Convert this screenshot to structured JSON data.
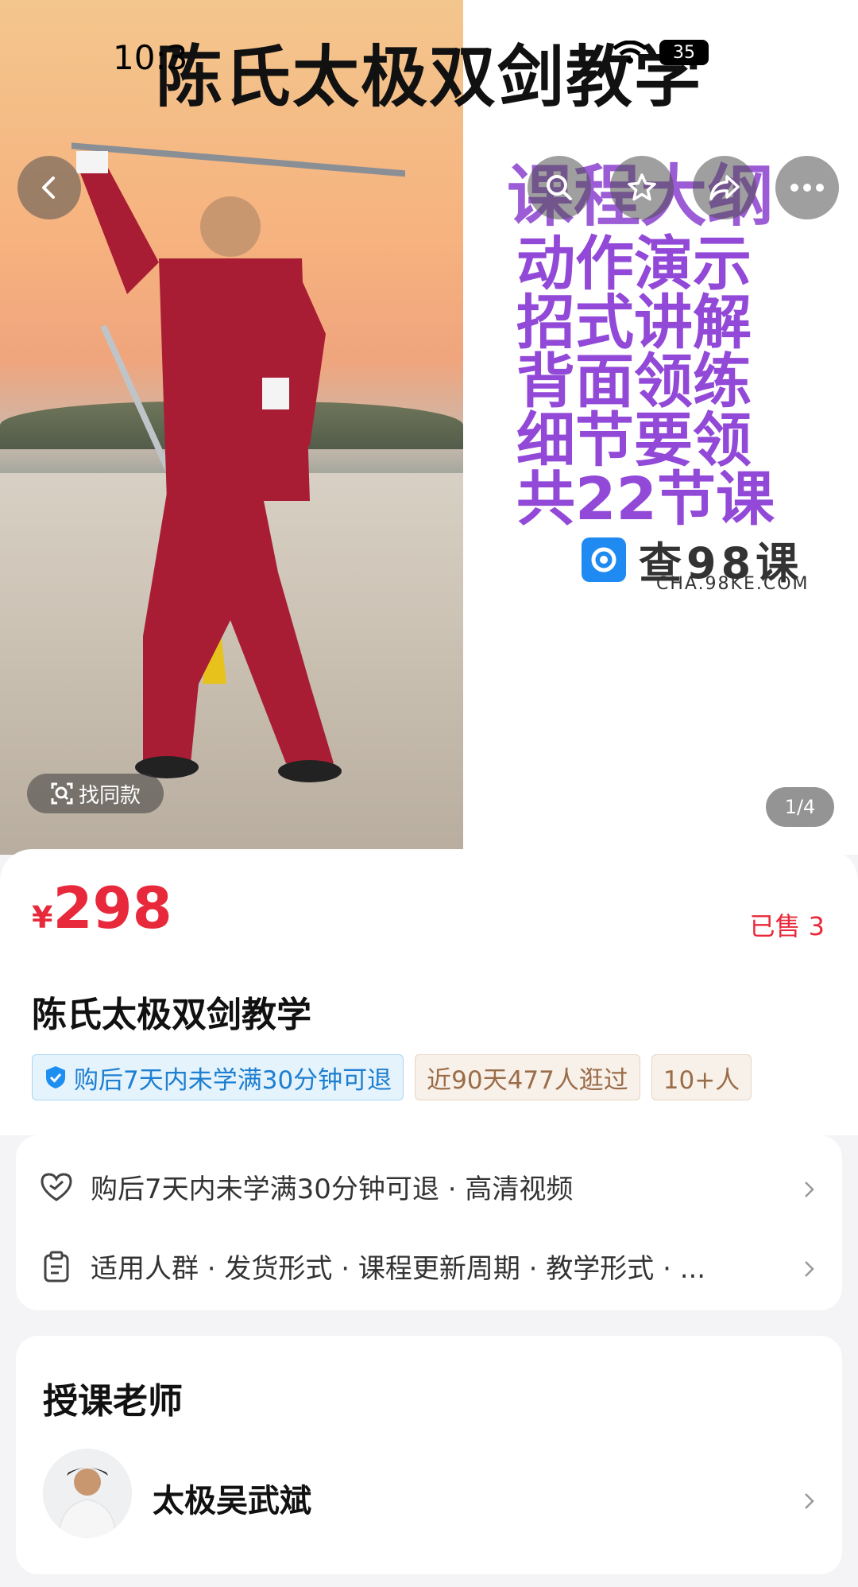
{
  "status": {
    "time": "10:3",
    "battery": "35"
  },
  "hero": {
    "banner_title": "陈氏太极双剑教学",
    "outline_title": "课程大纲",
    "outline_items": [
      "动作演示",
      "招式讲解",
      "背面领练",
      "细节要领",
      "共22节课"
    ],
    "watermark_text": "查98课",
    "watermark_url": "CHA.98KE.COM",
    "find_same_label": "找同款",
    "pager": "1/4"
  },
  "product": {
    "currency": "¥",
    "price": "298",
    "sold": "已售 3",
    "title": "陈氏太极双剑教学",
    "tags": [
      {
        "text": "购后7天内未学满30分钟可退",
        "style": "blue"
      },
      {
        "text": "近90天477人逛过",
        "style": "beige"
      },
      {
        "text": "10+人",
        "style": "beige"
      }
    ]
  },
  "services": {
    "rows": [
      {
        "icon": "heart-shield-icon",
        "text": "购后7天内未学满30分钟可退 · 高清视频"
      },
      {
        "icon": "clipboard-icon",
        "text": "适用人群 · 发货形式 · 课程更新周期 · 教学形式 · ..."
      }
    ]
  },
  "teacher": {
    "section_title": "授课老师",
    "name": "太极吴武斌"
  },
  "colors": {
    "accent": "#e8293b",
    "outline": "#9249d8",
    "tag_blue": "#1d7fd1"
  }
}
